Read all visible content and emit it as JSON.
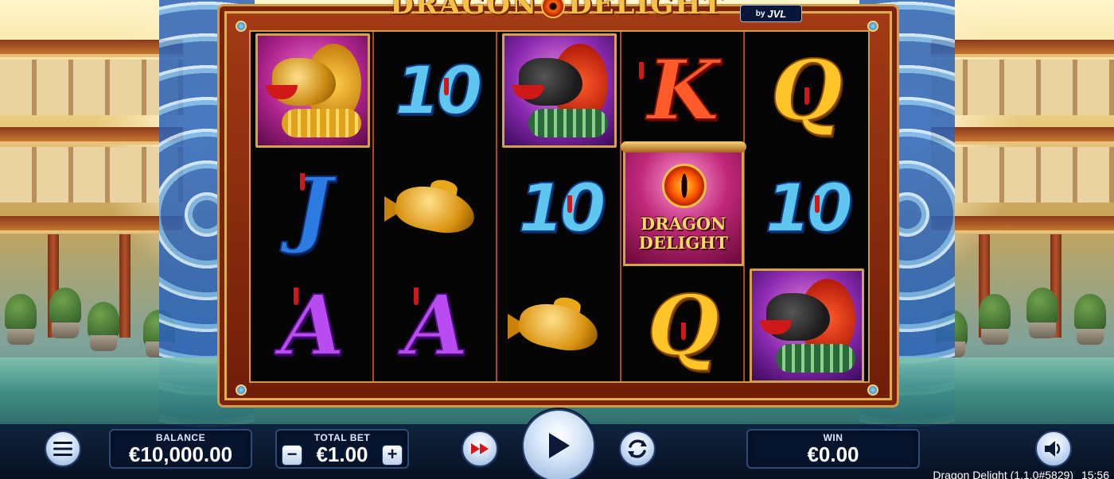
{
  "game": {
    "title_part1": "DRAGON",
    "title_part2": "DELIGHT",
    "provider_prefix": "by",
    "provider": "JVL"
  },
  "reels": [
    [
      "dragon-gold",
      "J",
      "A"
    ],
    [
      "10",
      "fish",
      "A"
    ],
    [
      "dragon-red",
      "10",
      "fish"
    ],
    [
      "K",
      "wild",
      "Q"
    ],
    [
      "Q",
      "10",
      "dragon-red"
    ]
  ],
  "symbols": {
    "ten": "10",
    "k": "K",
    "q": "Q",
    "j": "J",
    "a": "A",
    "wild_line1": "DRAGON",
    "wild_line2": "DELIGHT"
  },
  "controls": {
    "balance_label": "BALANCE",
    "balance_value": "€10,000.00",
    "bet_label": "TOTAL BET",
    "bet_value": "€1.00",
    "bet_minus": "−",
    "bet_plus": "+",
    "win_label": "WIN",
    "win_value": "€0.00"
  },
  "icons": {
    "menu": "hamburger-menu-icon",
    "fast": "fast-forward-icon",
    "spin": "play-icon",
    "autoplay": "refresh-icon",
    "sound": "speaker-icon"
  },
  "footer": {
    "game_version": "Dragon Delight (1.1.0#5829)",
    "clock": "15:56"
  },
  "colors": {
    "bar_bg": "#0a1937",
    "panel_bg": "#07142e",
    "frame_red": "#a33b16",
    "frame_gold": "#d49a45"
  }
}
